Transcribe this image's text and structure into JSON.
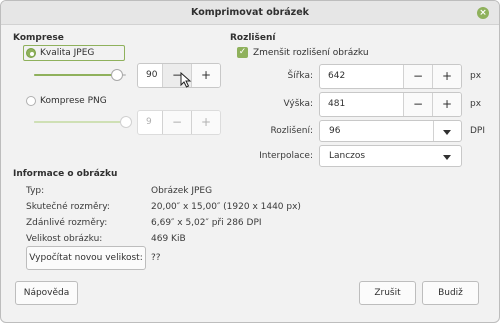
{
  "window": {
    "title": "Komprimovat obrázek",
    "close_icon": "close-icon"
  },
  "compression": {
    "section_title": "Komprese",
    "jpeg_label": "Kvalita JPEG",
    "jpeg_selected": true,
    "jpeg_quality_value": "90",
    "jpeg_slider_fraction": 0.9,
    "png_label": "Komprese PNG",
    "png_selected": false,
    "png_value": "9",
    "png_slider_fraction": 1.0,
    "minus_label": "−",
    "plus_label": "+"
  },
  "resolution": {
    "section_title": "Rozlišení",
    "shrink_label": "Zmenšit rozlišení obrázku",
    "shrink_checked": true,
    "width_label": "Šířka:",
    "width_value": "642",
    "width_unit": "px",
    "height_label": "Výška:",
    "height_value": "481",
    "height_unit": "px",
    "dpi_label": "Rozlišení:",
    "dpi_value": "96",
    "dpi_unit": "DPI",
    "interp_label": "Interpolace:",
    "interp_value": "Lanczos",
    "minus_label": "−",
    "plus_label": "+"
  },
  "info": {
    "section_title": "Informace o obrázku",
    "rows": [
      {
        "label": "Typ:",
        "value": "Obrázek JPEG"
      },
      {
        "label": "Skutečné rozměry:",
        "value": "20,00″ x 15,00″ (1920 x 1440 px)"
      },
      {
        "label": "Zdánlivé rozměry:",
        "value": "6,69″ x 5,02″ při 286 DPI"
      },
      {
        "label": "Velikost obrázku:",
        "value": "469 KiB"
      }
    ],
    "compute_button": "Vypočítat novou velikost:",
    "computed_value": "??"
  },
  "footer": {
    "help_button": "Nápověda",
    "cancel_button": "Zrušit",
    "ok_button": "Budiž"
  },
  "colors": {
    "accent": "#8fb15c"
  }
}
